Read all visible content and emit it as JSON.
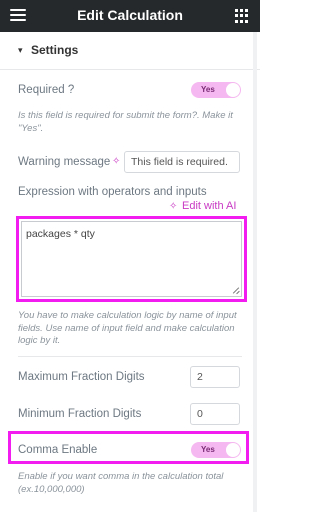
{
  "header": {
    "title": "Edit Calculation",
    "menu_icon": "hamburger-menu-icon",
    "apps_icon": "grid-apps-icon"
  },
  "section": {
    "caret": "▾",
    "title": "Settings"
  },
  "required": {
    "label": "Required ?",
    "toggle": "Yes",
    "description": "Is this field is required for submit the form?. Make it \"Yes\"."
  },
  "warning": {
    "label": "Warning message",
    "value": "This field is required.",
    "ai_icon": "sparkle-ai-icon"
  },
  "expression": {
    "label": "Expression with operators and inputs",
    "ai_link": "Edit with AI",
    "value": "packages * qty",
    "description": "You have to make calculation logic by name of input fields. Use name of input field and make calculation logic by it."
  },
  "max_fraction": {
    "label": "Maximum Fraction Digits",
    "value": "2"
  },
  "min_fraction": {
    "label": "Minimum Fraction Digits",
    "value": "0"
  },
  "comma": {
    "label": "Comma Enable",
    "toggle": "Yes",
    "description": "Enable if you want comma in the calculation total (ex.10,000,000)"
  },
  "colors": {
    "topbar": "#26292c",
    "accent": "#c93ac4",
    "highlight": "#f21bf0",
    "toggle_on": "#f5b8f0"
  }
}
